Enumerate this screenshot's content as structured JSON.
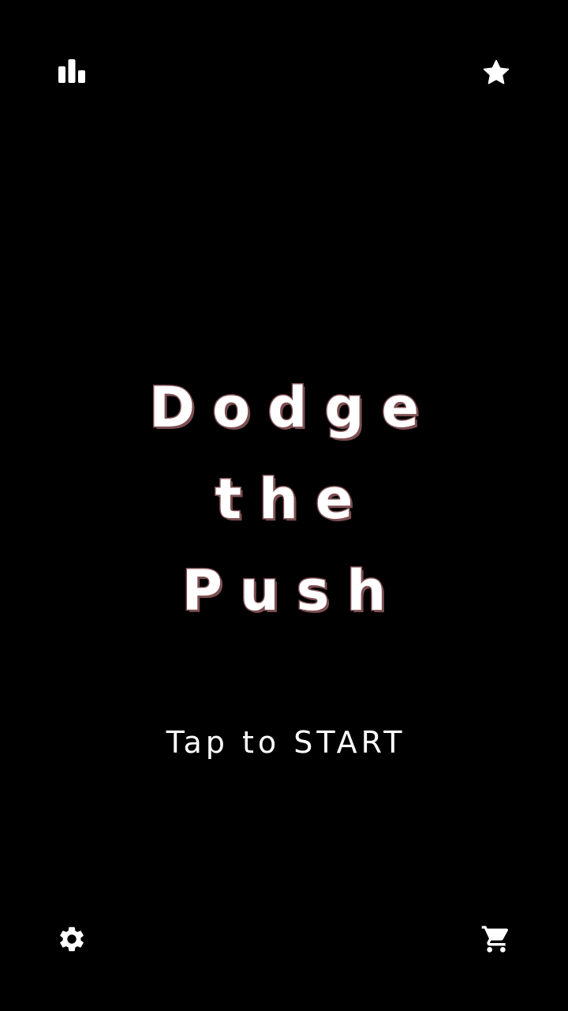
{
  "title_lines": [
    "Dodge",
    "the",
    "Push"
  ],
  "start_prompt": "Tap to START",
  "icons": {
    "top_left": "leaderboard-icon",
    "top_right": "star-icon",
    "bottom_left": "gear-icon",
    "bottom_right": "cart-icon"
  },
  "colors": {
    "background": "#000000",
    "text": "#ffffff",
    "title_outline": "#7d4f52",
    "icon": "#ffffff"
  }
}
